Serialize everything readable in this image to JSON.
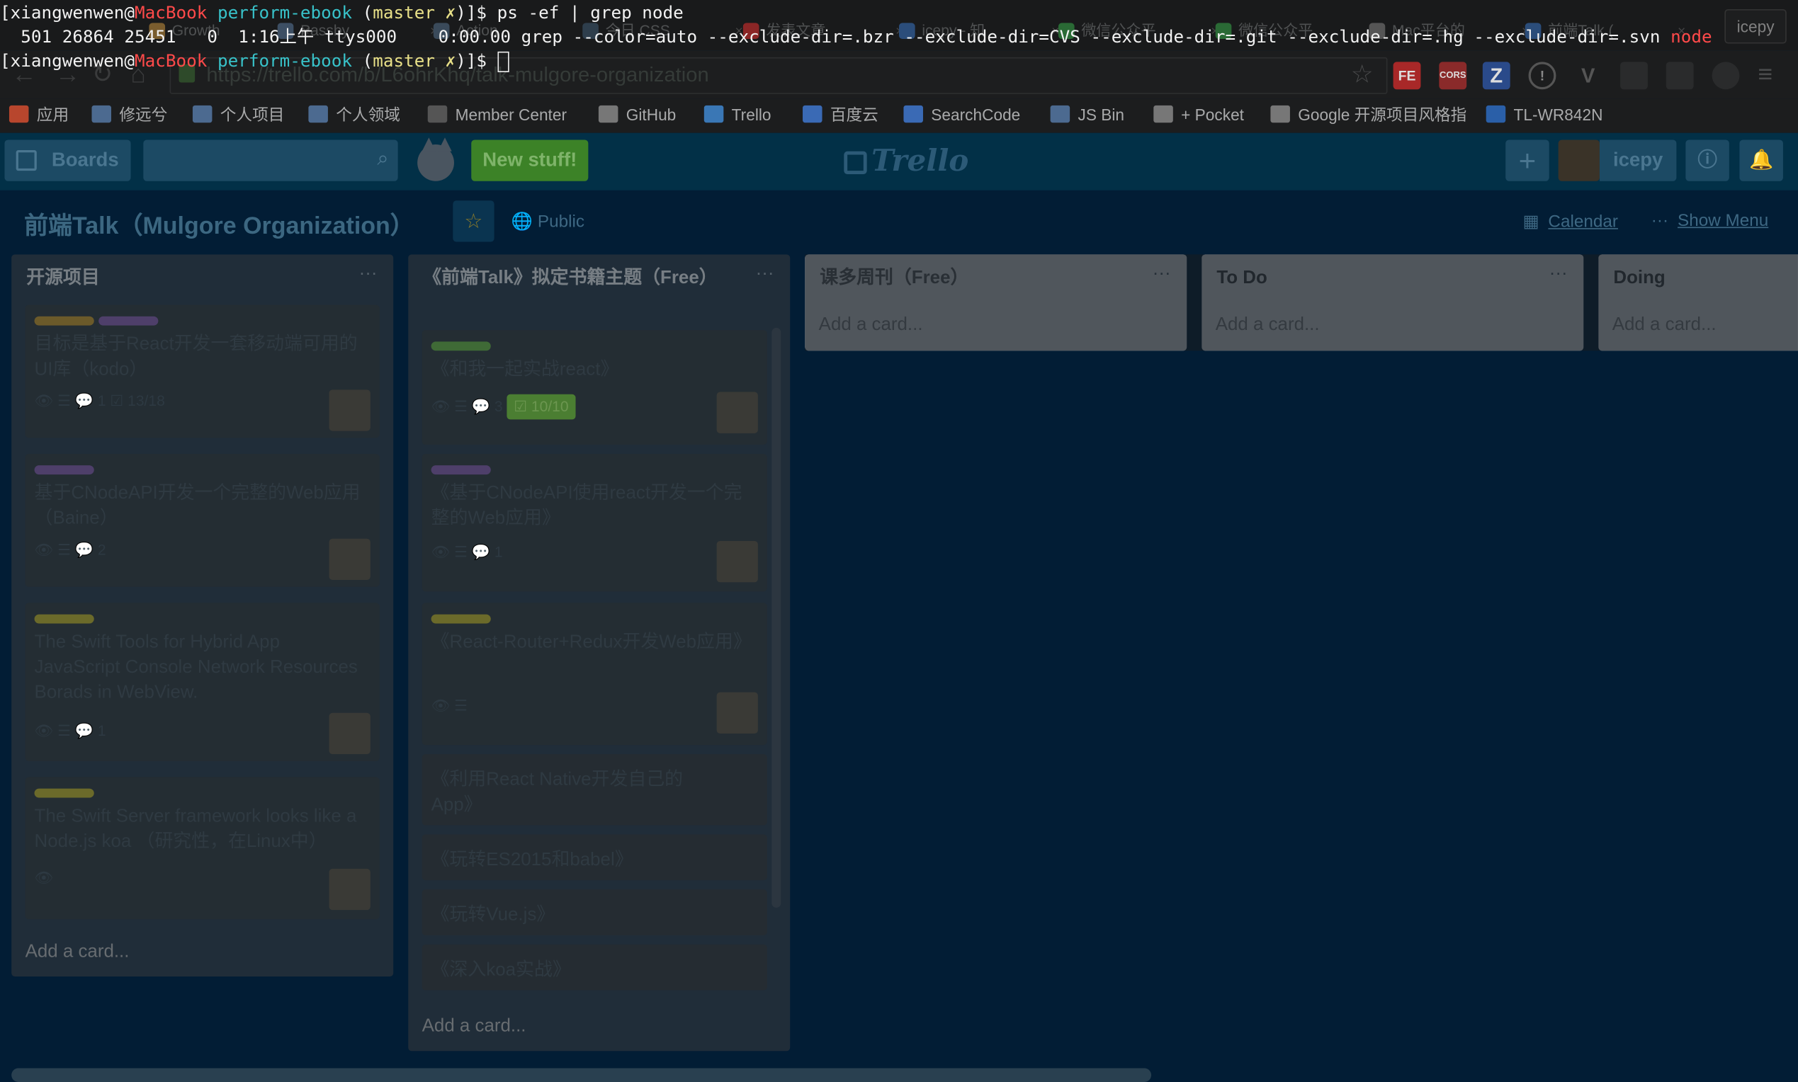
{
  "browser": {
    "tabs": [
      {
        "label": "Growth",
        "color": "#7a5d2e"
      },
      {
        "label": "Passby",
        "color": "#3d4f64"
      },
      {
        "label": "Action",
        "color": "#3a4a5a"
      },
      {
        "label": "今日 CSS",
        "color": "#2e3e4c"
      },
      {
        "label": "发表文章",
        "color": "#8b2626"
      },
      {
        "label": "icepy - 知",
        "color": "#2b4d7a"
      },
      {
        "label": "微信公众平",
        "color": "#2a6a35"
      },
      {
        "label": "微信公众平",
        "color": "#2a6a35"
      },
      {
        "label": "Mac平台的",
        "color": "#555"
      },
      {
        "label": "前端Talk (",
        "color": "#2b4d7a"
      }
    ],
    "profile_name": "icepy",
    "url": "https://trello.com/b/L6ohrKhq/talk-mulgore-organization",
    "bookmarks": [
      {
        "label": "应用",
        "color": "#b8462d"
      },
      {
        "label": "修远兮",
        "color": "#4c6a90"
      },
      {
        "label": "个人项目",
        "color": "#4c6a90"
      },
      {
        "label": "个人领域",
        "color": "#4c6a90"
      },
      {
        "label": "Member Center",
        "color": "#555"
      },
      {
        "label": "GitHub",
        "color": "#777"
      },
      {
        "label": "Trello",
        "color": "#3a77b5"
      },
      {
        "label": "百度云",
        "color": "#3a6ab5"
      },
      {
        "label": "SearchCode",
        "color": "#3a6ab5"
      },
      {
        "label": "JS Bin",
        "color": "#4c6a90"
      },
      {
        "label": "+ Pocket",
        "color": "#777"
      },
      {
        "label": "Google 开源项目风格指",
        "color": "#777"
      },
      {
        "label": "TL-WR842N",
        "color": "#2a5fa8"
      }
    ]
  },
  "terminal": {
    "line1": {
      "user": "[xiangwenwen@",
      "host": "MacBook",
      "dir": " perform-ebook",
      "branch_open": " (",
      "branch": "master ✗",
      "branch_close": ")]$ ",
      "cmd": "ps -ef | grep node"
    },
    "line2": {
      "text": "  501 26864 25451   0  1:16上午 ttys000    0:00.00 grep --color=auto --exclude-dir=.bzr --exclude-dir=CVS --exclude-dir=.git --exclude-dir=.hg --exclude-dir=.svn ",
      "match": "node"
    },
    "line3": {
      "user": "[xiangwenwen@",
      "host": "MacBook",
      "dir": " perform-ebook",
      "branch_open": " (",
      "branch": "master ✗",
      "branch_close": ")]$ "
    }
  },
  "header": {
    "boards_label": "Boards",
    "new_stuff": "New stuff!",
    "logo": "Trello",
    "user_name": "icepy"
  },
  "board": {
    "title": "前端Talk（Mulgore Organization）",
    "visibility": "Public",
    "calendar": "Calendar",
    "show_menu": "Show Menu"
  },
  "lists": [
    {
      "title": "开源项目",
      "cards": [
        {
          "labels": [
            "#6b5a2a",
            "#4e3f6a"
          ],
          "text": "目标是基于React开发一套移动端可用的UI库（kodo）",
          "badges": "👁  ☰  💬 1  ☑ 13/18"
        },
        {
          "labels": [
            "#4e3f6a"
          ],
          "text": "基于CNodeAPI开发一个完整的Web应用（Baine）",
          "badges": "👁  ☰  💬 2"
        },
        {
          "labels": [
            "#6b6a2a"
          ],
          "text": "The Swift Tools for Hybrid App JavaScript Console Network Resources Borads in WebView.",
          "badges": "👁  ☰  💬 1"
        },
        {
          "labels": [
            "#6b6a2a"
          ],
          "text": "The Swift Server framework looks like a Node.js koa （研究性，在Linux中）",
          "badges": "👁"
        }
      ],
      "add": "Add a card..."
    },
    {
      "title": "《前端Talk》拟定书籍主题（Free）",
      "cards": [
        {
          "labels": [
            "#3f6a36"
          ],
          "text": "《和我一起实战react》",
          "badges": "👁  ☰  💬 3",
          "checklist": "☑ 10/10"
        },
        {
          "labels": [
            "#4e3f6a"
          ],
          "text": "《基于CNodeAPI使用react开发一个完整的Web应用》",
          "badges": "👁  ☰  💬 1"
        },
        {
          "labels": [
            "#6b6a2a"
          ],
          "text": "《React-Router+Redux开发Web应用》",
          "badges": "👁  ☰"
        },
        {
          "text": "《利用React Native开发自己的App》"
        },
        {
          "text": "《玩转ES2015和babel》"
        },
        {
          "text": "《玩转Vue.js》"
        },
        {
          "text": "《深入koa实战》"
        }
      ],
      "add": "Add a card..."
    },
    {
      "title": "课多周刊（Free）",
      "add": "Add a card..."
    },
    {
      "title": "To Do",
      "add": "Add a card..."
    },
    {
      "title": "Doing",
      "add": "Add a card..."
    }
  ]
}
